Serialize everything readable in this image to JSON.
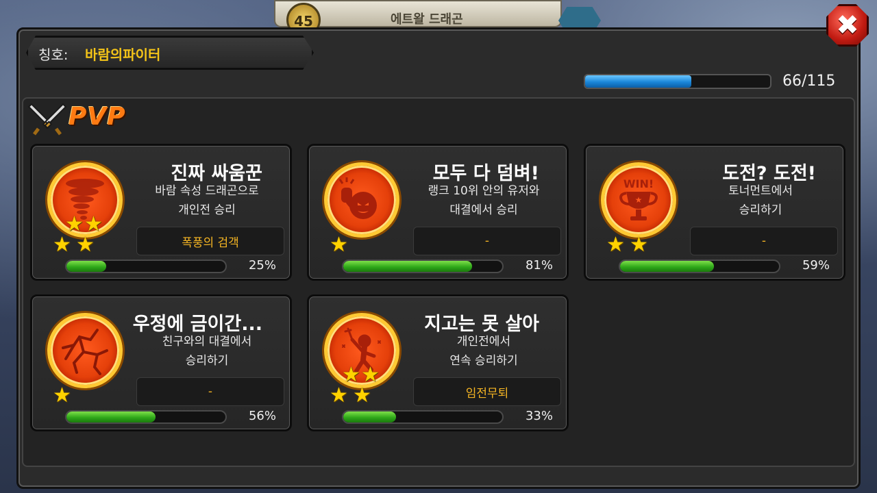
{
  "background": {
    "level": "45",
    "dragon_name": "에트왈 드래곤"
  },
  "header": {
    "title_label": "칭호:",
    "title_value": "바람의파이터",
    "progress_text": "66/115",
    "progress_fraction": 0.574
  },
  "section": {
    "name": "PVP",
    "icon": "crossed-swords-icon"
  },
  "colors": {
    "accent": "#f5c518",
    "pvp": "#ff7a12",
    "progress_blue": "#1a86d9",
    "bar_green": "#2fa81a",
    "close_red": "#c11b12"
  },
  "achievements": [
    {
      "title": "진짜 싸움꾼",
      "desc_line1": "바람 속성 드래곤으로",
      "desc_line2": "개인전 승리",
      "reward": "폭풍의 검객",
      "percent_text": "25%",
      "progress": 0.25,
      "stars": 4,
      "icon": "tornado-icon"
    },
    {
      "title": "모두 다 덤벼!",
      "desc_line1": "랭크 10위 안의 유저와",
      "desc_line2": "대결에서 승리",
      "reward": "-",
      "percent_text": "81%",
      "progress": 0.81,
      "stars": 1,
      "icon": "fighter-fist-icon"
    },
    {
      "title": "도전? 도전!",
      "desc_line1": "토너먼트에서",
      "desc_line2": "승리하기",
      "reward": "-",
      "percent_text": "59%",
      "progress": 0.59,
      "stars": 2,
      "icon": "win-trophy-icon"
    },
    {
      "title": "우정에 금이간...",
      "desc_line1": "친구와의 대결에서",
      "desc_line2": "승리하기",
      "reward": "-",
      "percent_text": "56%",
      "progress": 0.56,
      "stars": 1,
      "icon": "cracked-icon"
    },
    {
      "title": "지고는 못 살아",
      "desc_line1": "개인전에서",
      "desc_line2": "연속 승리하기",
      "reward": "임전무퇴",
      "percent_text": "33%",
      "progress": 0.33,
      "stars": 4,
      "icon": "victory-pose-icon"
    }
  ]
}
